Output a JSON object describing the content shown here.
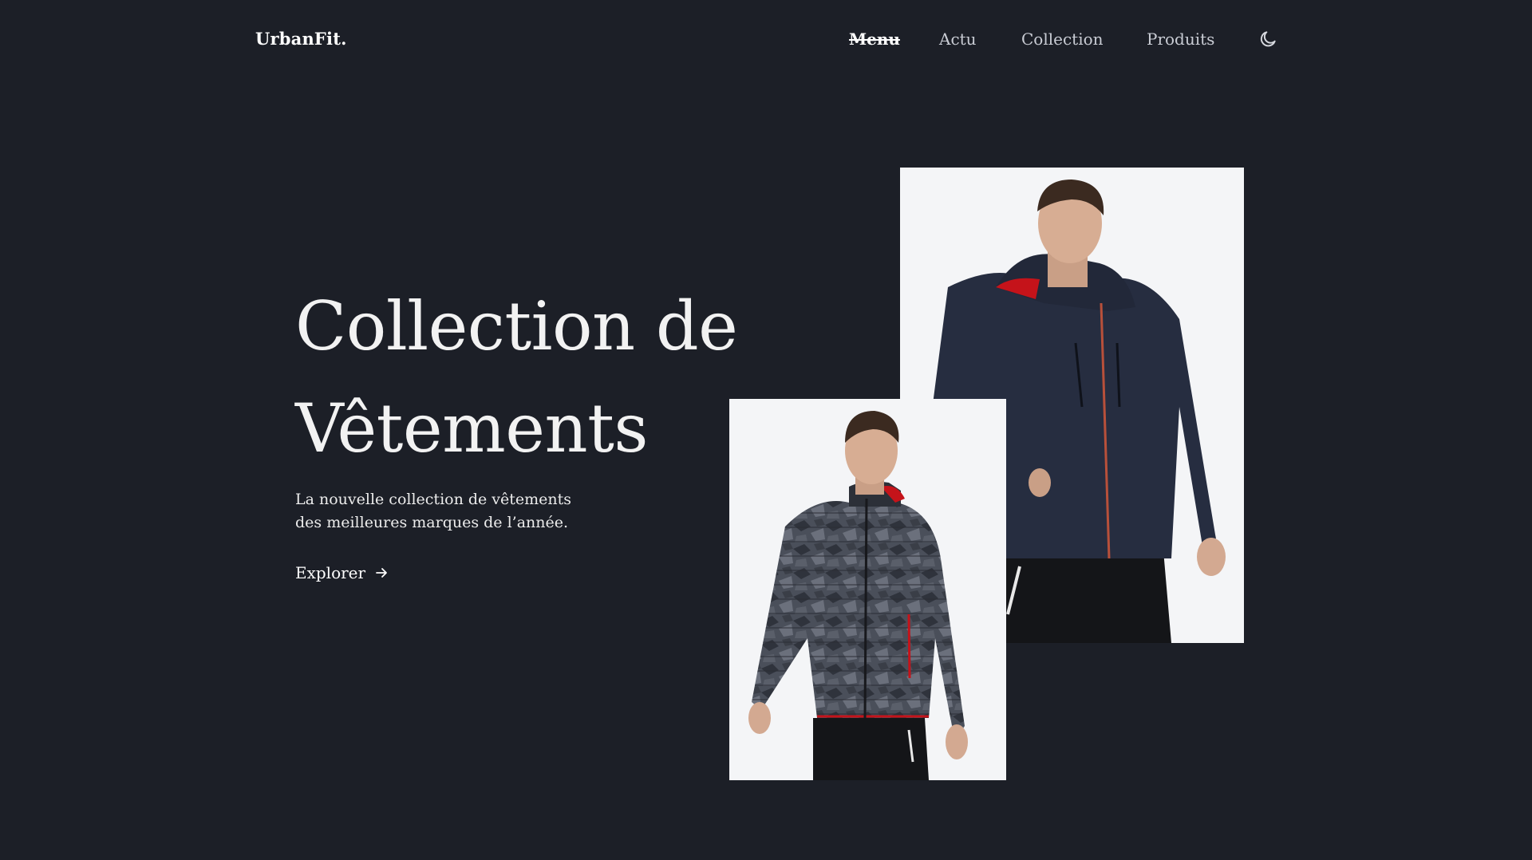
{
  "header": {
    "logo": "UrbanFit.",
    "nav": [
      {
        "label": "Menu"
      },
      {
        "label": "Actu"
      },
      {
        "label": "Collection"
      },
      {
        "label": "Produits"
      }
    ],
    "theme_icon": "moon-icon"
  },
  "hero": {
    "title_line1": "Collection de",
    "title_line2": "Vêtements",
    "subtitle_line1": "La nouvelle collection de vêtements",
    "subtitle_line2": "des meilleures marques de l’année.",
    "cta_label": "Explorer",
    "cta_icon": "arrow-right-icon"
  },
  "images": {
    "back": "man-in-navy-hooded-jacket-photo",
    "front": "man-in-camo-puffer-jacket-photo"
  },
  "colors": {
    "background": "#1c1f27",
    "text": "#ffffff",
    "nav_text": "#c9ccd4",
    "photo_bg": "#f4f5f7"
  }
}
